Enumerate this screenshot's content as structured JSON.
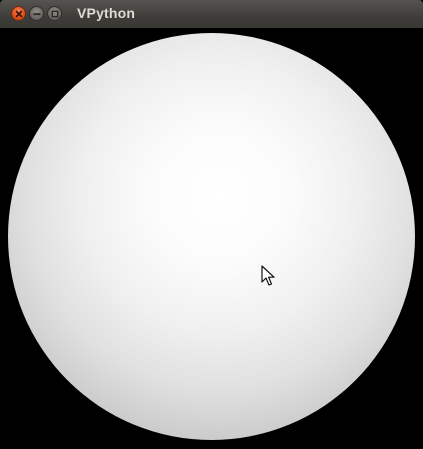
{
  "window": {
    "title": "VPython",
    "controls": [
      "close",
      "minimize",
      "maximize"
    ]
  },
  "scene": {
    "object": "sphere",
    "sphere_color": "#ffffff",
    "background_color": "#000000"
  },
  "colors": {
    "titlebar": "#3e3d39",
    "title_text": "#dfdbd2",
    "close_button": "#e0511d"
  },
  "cursor": {
    "type": "arrow-pointer"
  }
}
